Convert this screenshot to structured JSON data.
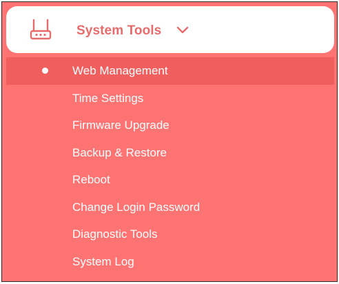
{
  "header": {
    "title": "System Tools",
    "icon": "router-icon",
    "expand_icon": "chevron-down-icon",
    "text_color": "#e86b6b"
  },
  "menu": {
    "active_index": 0,
    "items": [
      {
        "label": "Web Management",
        "active": true
      },
      {
        "label": "Time Settings"
      },
      {
        "label": "Firmware Upgrade"
      },
      {
        "label": "Backup & Restore"
      },
      {
        "label": "Reboot"
      },
      {
        "label": "Change Login Password"
      },
      {
        "label": "Diagnostic Tools"
      },
      {
        "label": "System Log"
      }
    ]
  },
  "colors": {
    "panel_bg": "#ff7373",
    "active_item_bg": "#f05e5e",
    "item_text": "#ffffff"
  }
}
